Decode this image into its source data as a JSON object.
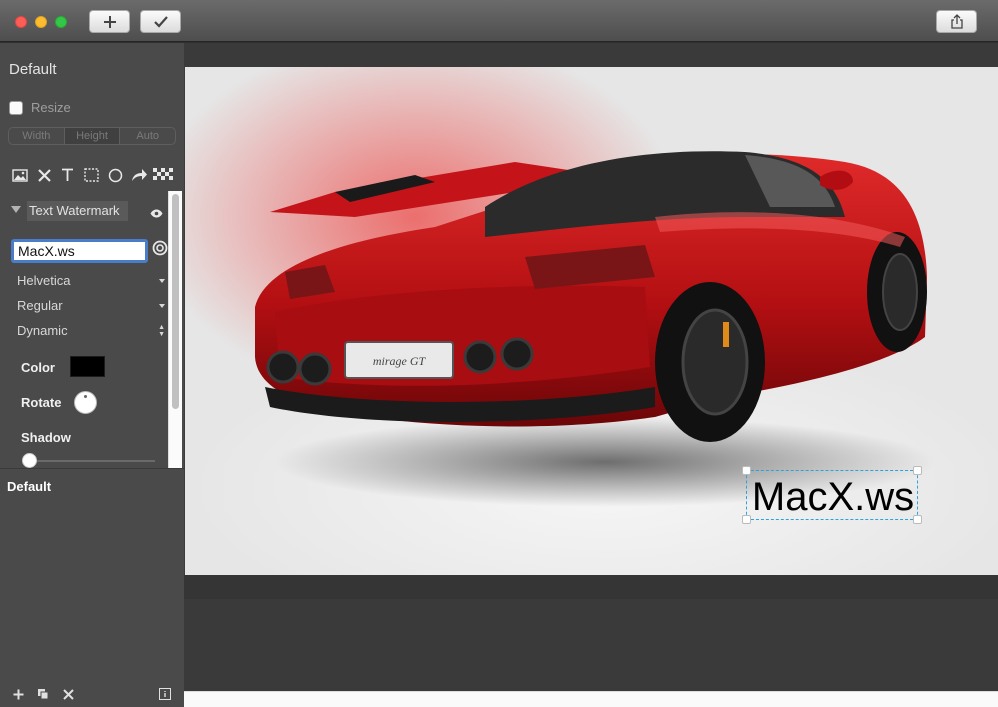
{
  "toolbar": {
    "add_icon": "plus-icon",
    "confirm_icon": "checkmark-icon",
    "share_icon": "share-icon"
  },
  "sidebar": {
    "preset_title": "Default",
    "resize": {
      "label": "Resize",
      "checked": false
    },
    "size_mode": {
      "options": [
        "Width",
        "Height",
        "Auto"
      ],
      "selected": "Height"
    },
    "tools": [
      "image-icon",
      "close-icon",
      "text-icon",
      "rectangle-icon",
      "circle-icon",
      "arrow-icon",
      "checker-icon"
    ],
    "section": {
      "label": "Text Watermark",
      "visible_icon": "eye-icon"
    },
    "text_value": "MacX.ws",
    "font_family": "Helvetica",
    "font_style": "Regular",
    "size_mode_value": "Dynamic",
    "labels": {
      "color": "Color",
      "rotate": "Rotate",
      "shadow": "Shadow"
    },
    "color_value": "#000000",
    "preset_list_title": "Default",
    "bottom_tools": [
      "add-icon",
      "duplicate-icon",
      "delete-icon",
      "info-icon"
    ]
  },
  "canvas": {
    "watermark_text": "MacX.ws",
    "selection_color": "#27a3e0",
    "image_subject": "red-sports-car"
  }
}
